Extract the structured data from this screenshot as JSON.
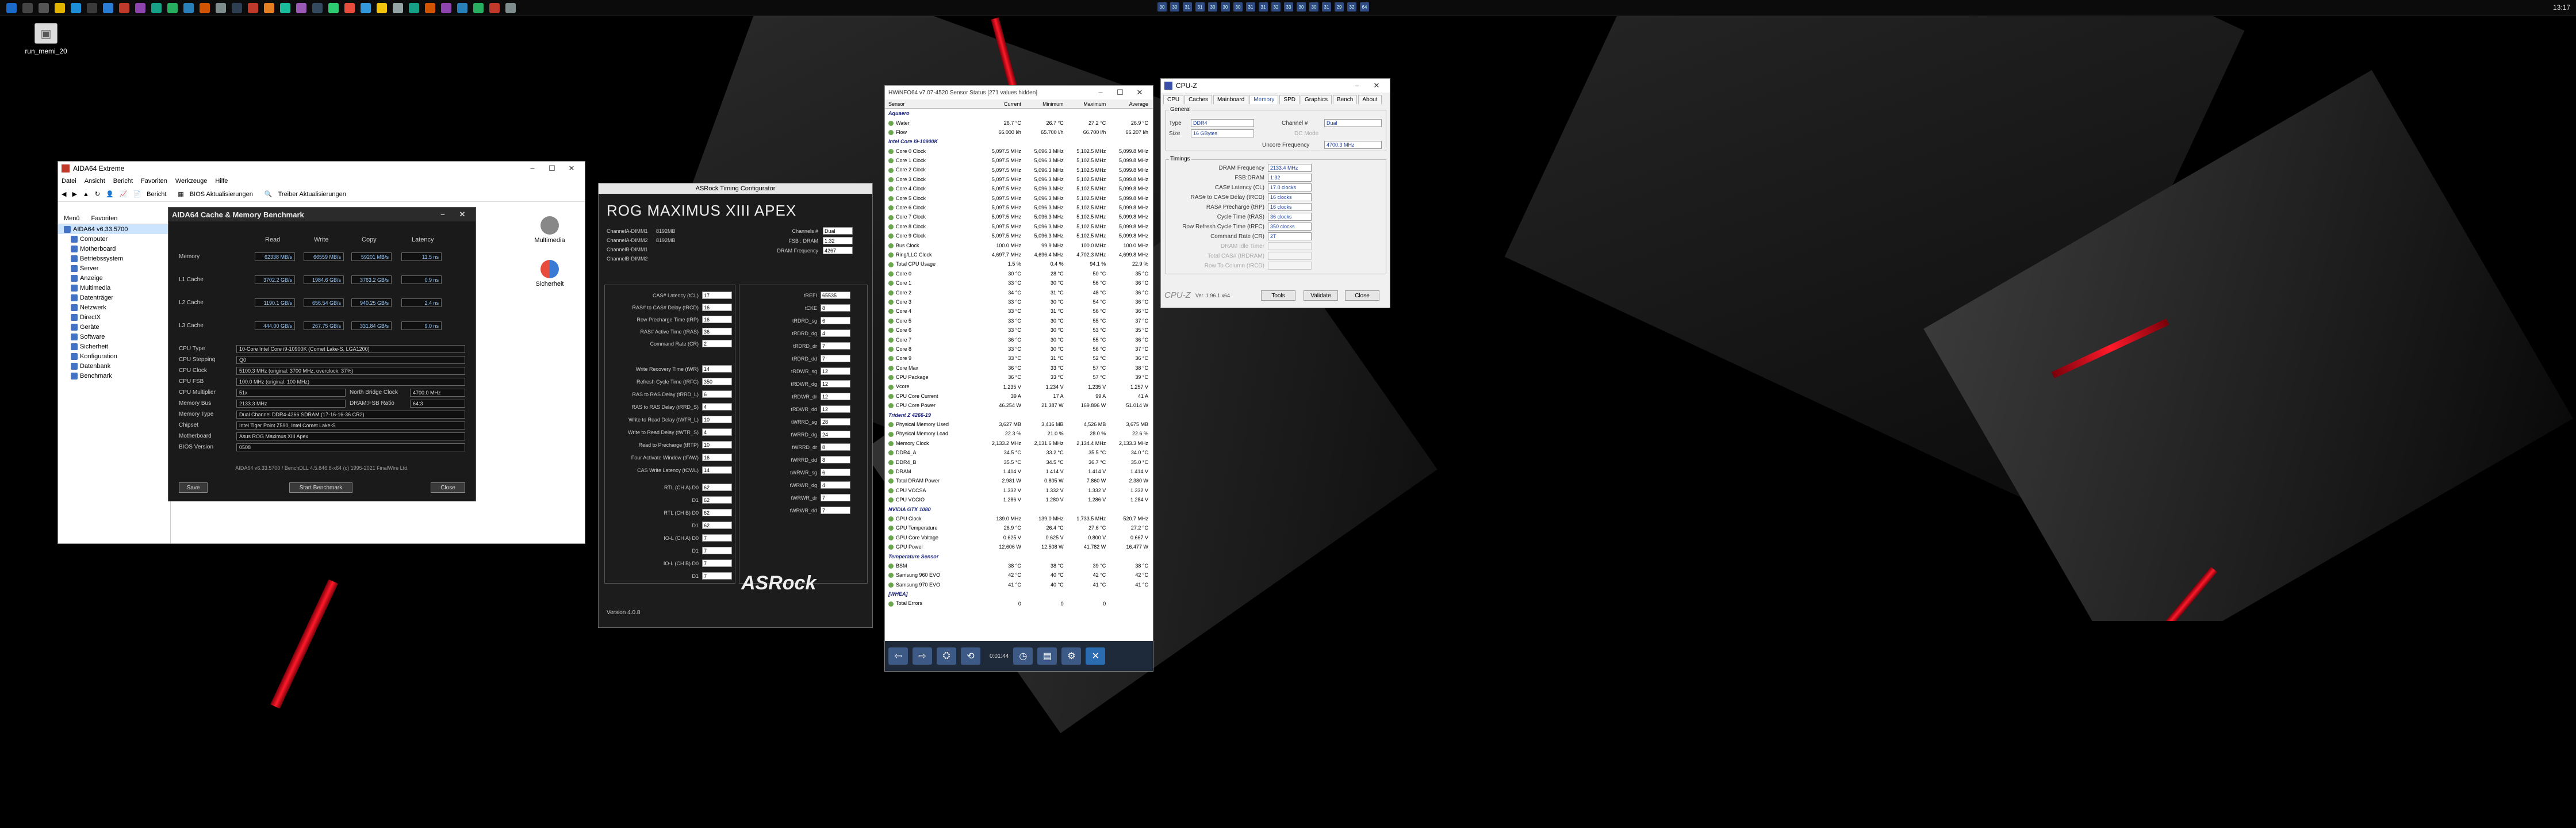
{
  "taskbar": {
    "clock": "13:17",
    "apps": [
      "start",
      "search",
      "task",
      "explorer",
      "edge",
      "store",
      "mail",
      "app1",
      "app2",
      "app3",
      "app4",
      "app5",
      "app6",
      "app7",
      "app8",
      "app9",
      "app10",
      "app11",
      "app12",
      "app13",
      "app14",
      "app15",
      "app16",
      "app17",
      "app18",
      "app19",
      "app20",
      "app21",
      "app22",
      "app23",
      "app24",
      "app25"
    ],
    "tray": [
      "30",
      "30",
      "31",
      "31",
      "30",
      "30",
      "30",
      "31",
      "31",
      "32",
      "33",
      "30",
      "30",
      "31",
      "29",
      "32",
      "64"
    ]
  },
  "desktop": {
    "icon_label": "run_memi_20"
  },
  "aida": {
    "title": "AIDA64 Extreme",
    "menu": [
      "Datei",
      "Ansicht",
      "Bericht",
      "Favoriten",
      "Werkzeuge",
      "Hilfe"
    ],
    "toolbar": {
      "report": "Bericht",
      "bios": "BIOS Aktualisierungen",
      "drivers": "Treiber Aktualisierungen"
    },
    "side_tabs": [
      "Menü",
      "Favoriten"
    ],
    "tree": [
      "AIDA64 v6.33.5700",
      "Computer",
      "Motherboard",
      "Betriebssystem",
      "Server",
      "Anzeige",
      "Multimedia",
      "Datenträger",
      "Netzwerk",
      "DirectX",
      "Geräte",
      "Software",
      "Sicherheit",
      "Konfiguration",
      "Datenbank",
      "Benchmark"
    ],
    "right_icons": [
      "Multimedia",
      "Sicherheit"
    ]
  },
  "bench": {
    "title": "AIDA64 Cache & Memory Benchmark",
    "cols": [
      "Read",
      "Write",
      "Copy",
      "Latency"
    ],
    "rows": [
      {
        "label": "Memory",
        "vals": [
          "62338 MB/s",
          "66559 MB/s",
          "59201 MB/s",
          "11.5 ns"
        ]
      },
      {
        "label": "L1 Cache",
        "vals": [
          "3702.2 GB/s",
          "1984.6 GB/s",
          "3763.2 GB/s",
          "0.9 ns"
        ]
      },
      {
        "label": "L2 Cache",
        "vals": [
          "1190.1 GB/s",
          "656.54 GB/s",
          "940.25 GB/s",
          "2.4 ns"
        ]
      },
      {
        "label": "L3 Cache",
        "vals": [
          "444.00 GB/s",
          "267.75 GB/s",
          "331.84 GB/s",
          "9.0 ns"
        ]
      }
    ],
    "info": [
      {
        "label": "CPU Type",
        "val": "10-Core Intel Core i9-10900K (Comet Lake-S, LGA1200)"
      },
      {
        "label": "CPU Stepping",
        "val": "Q0"
      },
      {
        "label": "CPU Clock",
        "val": "5100.3 MHz (original: 3700 MHz, overclock: 37%)"
      },
      {
        "label": "CPU FSB",
        "val": "100.0 MHz (original: 100 MHz)"
      },
      {
        "label": "CPU Multiplier",
        "val": "51x",
        "extra_label": "North Bridge Clock",
        "extra_val": "4700.0 MHz"
      },
      {
        "label": "Memory Bus",
        "val": "2133.3 MHz",
        "extra_label": "DRAM:FSB Ratio",
        "extra_val": "64:3"
      },
      {
        "label": "Memory Type",
        "val": "Dual Channel DDR4-4266 SDRAM (17-16-16-36 CR2)"
      },
      {
        "label": "Chipset",
        "val": "Intel Tiger Point Z590, Intel Comet Lake-S"
      },
      {
        "label": "Motherboard",
        "val": "Asus ROG Maximus XIII Apex"
      },
      {
        "label": "BIOS Version",
        "val": "0508"
      }
    ],
    "footer": "AIDA64 v6.33.5700 / BenchDLL 4.5.846.8-x64 (c) 1995-2021 FinalWire Ltd.",
    "buttons": {
      "save": "Save",
      "start": "Start Benchmark",
      "close": "Close"
    }
  },
  "asrock": {
    "title": "ASRock Timing Configurator",
    "board": "ROG MAXIMUS XIII APEX",
    "channels": [
      {
        "label": "ChannelA-DIMM1",
        "val": "8192MB"
      },
      {
        "label": "ChannelA-DIMM2",
        "val": "8192MB"
      },
      {
        "label": "ChannelB-DIMM1",
        "val": ""
      },
      {
        "label": "ChannelB-DIMM2",
        "val": ""
      }
    ],
    "top_right": [
      {
        "label": "Channels #",
        "val": "Dual"
      },
      {
        "label": "FSB : DRAM",
        "val": "1:32"
      },
      {
        "label": "DRAM Frequency",
        "val": "4267"
      }
    ],
    "primary": [
      {
        "label": "CAS# Latency (tCL)",
        "val": "17"
      },
      {
        "label": "RAS# to CAS# Delay (tRCD)",
        "val": "16"
      },
      {
        "label": "Row Precharge Time (tRP)",
        "val": "16"
      },
      {
        "label": "RAS# Active Time (tRAS)",
        "val": "36"
      },
      {
        "label": "Command Rate (CR)",
        "val": "2"
      }
    ],
    "secondary": [
      {
        "label": "Write Recovery Time (tWR)",
        "val": "14"
      },
      {
        "label": "Refresh Cycle Time (tRFC)",
        "val": "350"
      },
      {
        "label": "RAS to RAS Delay (tRRD_L)",
        "val": "6"
      },
      {
        "label": "RAS to RAS Delay (tRRD_S)",
        "val": "4"
      },
      {
        "label": "Write to Read Delay (tWTR_L)",
        "val": "10"
      },
      {
        "label": "Write to Read Delay (tWTR_S)",
        "val": "4"
      },
      {
        "label": "Read to Precharge (tRTP)",
        "val": "10"
      },
      {
        "label": "Four Activate Window (tFAW)",
        "val": "16"
      },
      {
        "label": "CAS Write Latency (tCWL)",
        "val": "14"
      }
    ],
    "right": [
      {
        "label": "tREFI",
        "val": "65535"
      },
      {
        "label": "tCKE",
        "val": "8"
      },
      {
        "label": "tRDRD_sg",
        "val": "6"
      },
      {
        "label": "tRDRD_dg",
        "val": "4"
      },
      {
        "label": "tRDRD_dr",
        "val": "7"
      },
      {
        "label": "tRDRD_dd",
        "val": "7"
      },
      {
        "label": "tRDWR_sg",
        "val": "12"
      },
      {
        "label": "tRDWR_dg",
        "val": "12"
      },
      {
        "label": "tRDWR_dr",
        "val": "12"
      },
      {
        "label": "tRDWR_dd",
        "val": "12"
      },
      {
        "label": "tWRRD_sg",
        "val": "28"
      },
      {
        "label": "tWRRD_dg",
        "val": "24"
      },
      {
        "label": "tWRRD_dr",
        "val": "8"
      },
      {
        "label": "tWRRD_dd",
        "val": "8"
      },
      {
        "label": "tWRWR_sg",
        "val": "6"
      },
      {
        "label": "tWRWR_dg",
        "val": "4"
      },
      {
        "label": "tWRWR_dr",
        "val": "7"
      },
      {
        "label": "tWRWR_dd",
        "val": "7"
      }
    ],
    "rtl": [
      {
        "label": "RTL (CH A) D0",
        "val": "62"
      },
      {
        "label": "D1",
        "val": "62"
      },
      {
        "label": "RTL (CH B) D0",
        "val": "62"
      },
      {
        "label": "D1",
        "val": "62"
      },
      {
        "label": "IO-L (CH A) D0",
        "val": "7"
      },
      {
        "label": "D1",
        "val": "7"
      },
      {
        "label": "IO-L (CH B) D0",
        "val": "7"
      },
      {
        "label": "D1",
        "val": "7"
      }
    ],
    "logo": "ASRock",
    "version": "Version 4.0.8"
  },
  "hwinfo": {
    "title": "HWiNFO64 v7.07-4520 Sensor Status [271 values hidden]",
    "headers": [
      "Sensor",
      "Current",
      "Minimum",
      "Maximum",
      "Average"
    ],
    "rows": [
      {
        "g": "Aquaero"
      },
      {
        "n": "Water",
        "v": [
          "26.7 °C",
          "26.7 °C",
          "27.2 °C",
          "26.9 °C"
        ]
      },
      {
        "n": "Flow",
        "v": [
          "66.000 l/h",
          "65.700 l/h",
          "66.700 l/h",
          "66.207 l/h"
        ]
      },
      {
        "g": "Intel Core i9-10900K"
      },
      {
        "n": "Core 0 Clock",
        "v": [
          "5,097.5 MHz",
          "5,096.3 MHz",
          "5,102.5 MHz",
          "5,099.8 MHz"
        ]
      },
      {
        "n": "Core 1 Clock",
        "v": [
          "5,097.5 MHz",
          "5,096.3 MHz",
          "5,102.5 MHz",
          "5,099.8 MHz"
        ]
      },
      {
        "n": "Core 2 Clock",
        "v": [
          "5,097.5 MHz",
          "5,096.3 MHz",
          "5,102.5 MHz",
          "5,099.8 MHz"
        ]
      },
      {
        "n": "Core 3 Clock",
        "v": [
          "5,097.5 MHz",
          "5,096.3 MHz",
          "5,102.5 MHz",
          "5,099.8 MHz"
        ]
      },
      {
        "n": "Core 4 Clock",
        "v": [
          "5,097.5 MHz",
          "5,096.3 MHz",
          "5,102.5 MHz",
          "5,099.8 MHz"
        ]
      },
      {
        "n": "Core 5 Clock",
        "v": [
          "5,097.5 MHz",
          "5,096.3 MHz",
          "5,102.5 MHz",
          "5,099.8 MHz"
        ]
      },
      {
        "n": "Core 6 Clock",
        "v": [
          "5,097.5 MHz",
          "5,096.3 MHz",
          "5,102.5 MHz",
          "5,099.8 MHz"
        ]
      },
      {
        "n": "Core 7 Clock",
        "v": [
          "5,097.5 MHz",
          "5,096.3 MHz",
          "5,102.5 MHz",
          "5,099.8 MHz"
        ]
      },
      {
        "n": "Core 8 Clock",
        "v": [
          "5,097.5 MHz",
          "5,096.3 MHz",
          "5,102.5 MHz",
          "5,099.8 MHz"
        ]
      },
      {
        "n": "Core 9 Clock",
        "v": [
          "5,097.5 MHz",
          "5,096.3 MHz",
          "5,102.5 MHz",
          "5,099.8 MHz"
        ]
      },
      {
        "n": "Bus Clock",
        "v": [
          "100.0 MHz",
          "99.9 MHz",
          "100.0 MHz",
          "100.0 MHz"
        ]
      },
      {
        "n": "Ring/LLC Clock",
        "v": [
          "4,697.7 MHz",
          "4,696.4 MHz",
          "4,702.3 MHz",
          "4,699.8 MHz"
        ]
      },
      {
        "n": "Total CPU Usage",
        "v": [
          "1.5 %",
          "0.4 %",
          "94.1 %",
          "22.9 %"
        ]
      },
      {
        "n": "Core 0",
        "v": [
          "30 °C",
          "28 °C",
          "50 °C",
          "35 °C"
        ]
      },
      {
        "n": "Core 1",
        "v": [
          "33 °C",
          "30 °C",
          "56 °C",
          "36 °C"
        ]
      },
      {
        "n": "Core 2",
        "v": [
          "34 °C",
          "31 °C",
          "48 °C",
          "36 °C"
        ]
      },
      {
        "n": "Core 3",
        "v": [
          "33 °C",
          "30 °C",
          "54 °C",
          "36 °C"
        ]
      },
      {
        "n": "Core 4",
        "v": [
          "33 °C",
          "31 °C",
          "56 °C",
          "36 °C"
        ]
      },
      {
        "n": "Core 5",
        "v": [
          "33 °C",
          "30 °C",
          "55 °C",
          "37 °C"
        ]
      },
      {
        "n": "Core 6",
        "v": [
          "33 °C",
          "30 °C",
          "53 °C",
          "35 °C"
        ]
      },
      {
        "n": "Core 7",
        "v": [
          "36 °C",
          "30 °C",
          "55 °C",
          "36 °C"
        ]
      },
      {
        "n": "Core 8",
        "v": [
          "33 °C",
          "30 °C",
          "56 °C",
          "37 °C"
        ]
      },
      {
        "n": "Core 9",
        "v": [
          "33 °C",
          "31 °C",
          "52 °C",
          "36 °C"
        ]
      },
      {
        "n": "Core Max",
        "v": [
          "36 °C",
          "33 °C",
          "57 °C",
          "38 °C"
        ]
      },
      {
        "n": "CPU Package",
        "v": [
          "36 °C",
          "33 °C",
          "57 °C",
          "39 °C"
        ]
      },
      {
        "n": "Vcore",
        "v": [
          "1.235 V",
          "1.234 V",
          "1.235 V",
          "1.257 V"
        ]
      },
      {
        "n": "CPU Core Current",
        "v": [
          "39 A",
          "17 A",
          "99 A",
          "41 A"
        ]
      },
      {
        "n": "CPU Core Power",
        "v": [
          "46.254 W",
          "21.387 W",
          "169.896 W",
          "51.014 W"
        ]
      },
      {
        "g": "Trident Z 4266-19"
      },
      {
        "n": "Physical Memory Used",
        "v": [
          "3,627 MB",
          "3,416 MB",
          "4,526 MB",
          "3,675 MB"
        ]
      },
      {
        "n": "Physical Memory Load",
        "v": [
          "22.3 %",
          "21.0 %",
          "28.0 %",
          "22.6 %"
        ]
      },
      {
        "n": "Memory Clock",
        "v": [
          "2,133.2 MHz",
          "2,131.6 MHz",
          "2,134.4 MHz",
          "2,133.3 MHz"
        ]
      },
      {
        "n": "DDR4_A",
        "v": [
          "34.5 °C",
          "33.2 °C",
          "35.5 °C",
          "34.0 °C"
        ]
      },
      {
        "n": "DDR4_B",
        "v": [
          "35.5 °C",
          "34.5 °C",
          "36.7 °C",
          "35.0 °C"
        ]
      },
      {
        "n": "DRAM",
        "v": [
          "1.414 V",
          "1.414 V",
          "1.414 V",
          "1.414 V"
        ]
      },
      {
        "n": "Total DRAM Power",
        "v": [
          "2.981 W",
          "0.805 W",
          "7.860 W",
          "2.380 W"
        ]
      },
      {
        "n": "CPU VCCSA",
        "v": [
          "1.332 V",
          "1.332 V",
          "1.332 V",
          "1.332 V"
        ]
      },
      {
        "n": "CPU VCCIO",
        "v": [
          "1.286 V",
          "1.280 V",
          "1.286 V",
          "1.284 V"
        ]
      },
      {
        "g": "NVIDIA GTX 1080"
      },
      {
        "n": "GPU Clock",
        "v": [
          "139.0 MHz",
          "139.0 MHz",
          "1,733.5 MHz",
          "520.7 MHz"
        ]
      },
      {
        "n": "GPU Temperature",
        "v": [
          "26.9 °C",
          "26.4 °C",
          "27.6 °C",
          "27.2 °C"
        ]
      },
      {
        "n": "GPU Core Voltage",
        "v": [
          "0.625 V",
          "0.625 V",
          "0.800 V",
          "0.667 V"
        ]
      },
      {
        "n": "GPU Power",
        "v": [
          "12.606 W",
          "12.508 W",
          "41.782 W",
          "16.477 W"
        ]
      },
      {
        "g": "Temperature Sensor"
      },
      {
        "n": "BSM",
        "v": [
          "38 °C",
          "38 °C",
          "39 °C",
          "38 °C"
        ]
      },
      {
        "n": "Samsung 960 EVO",
        "v": [
          "42 °C",
          "40 °C",
          "42 °C",
          "42 °C"
        ]
      },
      {
        "n": "Samsung 970 EVO",
        "v": [
          "41 °C",
          "40 °C",
          "41 °C",
          "41 °C"
        ]
      },
      {
        "g": "[WHEA]"
      },
      {
        "n": "Total Errors",
        "v": [
          "0",
          "0",
          "0",
          ""
        ]
      }
    ],
    "time": "0:01:44"
  },
  "cpuz": {
    "title": "CPU-Z",
    "tabs": [
      "CPU",
      "Caches",
      "Mainboard",
      "Memory",
      "SPD",
      "Graphics",
      "Bench",
      "About"
    ],
    "active": "Memory",
    "general": {
      "title": "General",
      "type_label": "Type",
      "type": "DDR4",
      "size_label": "Size",
      "size": "16 GBytes",
      "channel_label": "Channel #",
      "channel": "Dual",
      "dcmode_label": "DC Mode",
      "uncore_label": "Uncore Frequency",
      "uncore": "4700.3 MHz"
    },
    "timings": {
      "title": "Timings",
      "rows": [
        {
          "label": "DRAM Frequency",
          "val": "2133.4 MHz"
        },
        {
          "label": "FSB:DRAM",
          "val": "1:32"
        },
        {
          "label": "CAS# Latency (CL)",
          "val": "17.0 clocks"
        },
        {
          "label": "RAS# to CAS# Delay (tRCD)",
          "val": "16 clocks"
        },
        {
          "label": "RAS# Precharge (tRP)",
          "val": "16 clocks"
        },
        {
          "label": "Cycle Time (tRAS)",
          "val": "36 clocks"
        },
        {
          "label": "Row Refresh Cycle Time (tRFC)",
          "val": "350 clocks"
        },
        {
          "label": "Command Rate (CR)",
          "val": "2T"
        }
      ],
      "gray": [
        "DRAM Idle Timer",
        "Total CAS# (tRDRAM)",
        "Row To Column (tRCD)"
      ]
    },
    "footer": {
      "brand": "CPU-Z",
      "ver": "Ver. 1.96.1.x64",
      "tools": "Tools",
      "validate": "Validate",
      "close": "Close"
    }
  }
}
